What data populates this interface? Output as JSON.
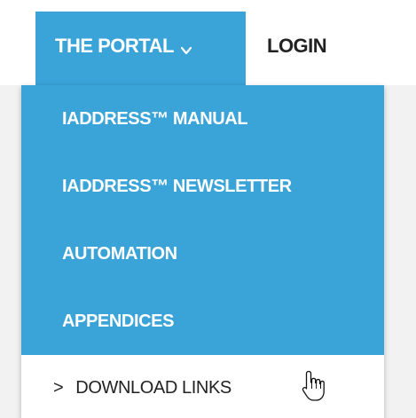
{
  "nav": {
    "portal_label": "THE PORTAL",
    "login_label": "LOGIN"
  },
  "dropdown": {
    "items": [
      {
        "label": "IADDRESS™ MANUAL"
      },
      {
        "label": "IADDRESS™ NEWSLETTER"
      },
      {
        "label": "AUTOMATION"
      },
      {
        "label": "APPENDICES"
      },
      {
        "label": "DOWNLOAD LINKS",
        "hovered": true
      }
    ],
    "hover_arrow": ">"
  },
  "colors": {
    "accent": "#3aa3d8",
    "menu_text": "#ffffff",
    "hover_bg": "#ffffff",
    "hover_text": "#222222",
    "page_band": "#f2f2f2"
  },
  "icons": {
    "portal_chevron": "chevron-down-icon",
    "pointer": "hand-pointer-cursor-icon"
  }
}
